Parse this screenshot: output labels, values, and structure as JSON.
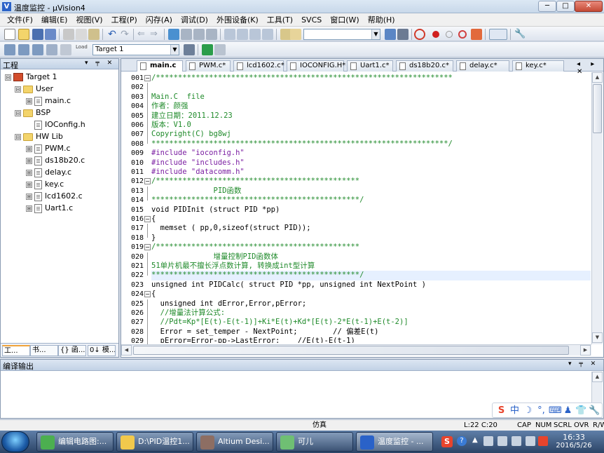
{
  "window": {
    "title": "温度监控 - μVision4",
    "app_icon": "V",
    "minimize": "─",
    "maximize": "□",
    "close": "✕"
  },
  "menu": [
    "文件(F)",
    "编辑(E)",
    "视图(V)",
    "工程(P)",
    "闪存(A)",
    "调试(D)",
    "外围设备(K)",
    "工具(T)",
    "SVCS",
    "窗口(W)",
    "帮助(H)"
  ],
  "toolbar2": {
    "target_select": "Target 1",
    "load_label": "Load"
  },
  "project": {
    "title": "工程",
    "controls": "▾ ╤ ✕",
    "tree": [
      {
        "label": "Target 1",
        "kind": "target",
        "level": 0,
        "expander": "⊟"
      },
      {
        "label": "User",
        "kind": "folder",
        "level": 1,
        "expander": "⊟"
      },
      {
        "label": "main.c",
        "kind": "file",
        "level": 2,
        "expander": "⊞"
      },
      {
        "label": "BSP",
        "kind": "folder",
        "level": 1,
        "expander": "⊟"
      },
      {
        "label": "IOConfig.h",
        "kind": "file",
        "level": 2,
        "expander": ""
      },
      {
        "label": "HW Lib",
        "kind": "folder",
        "level": 1,
        "expander": "⊟"
      },
      {
        "label": "PWM.c",
        "kind": "file",
        "level": 2,
        "expander": "⊞"
      },
      {
        "label": "ds18b20.c",
        "kind": "file",
        "level": 2,
        "expander": "⊞"
      },
      {
        "label": "delay.c",
        "kind": "file",
        "level": 2,
        "expander": "⊞"
      },
      {
        "label": "key.c",
        "kind": "file",
        "level": 2,
        "expander": "⊞"
      },
      {
        "label": "lcd1602.c",
        "kind": "file",
        "level": 2,
        "expander": "⊞"
      },
      {
        "label": "Uart1.c",
        "kind": "file",
        "level": 2,
        "expander": "⊞"
      }
    ],
    "tabs": [
      "工...",
      "书...",
      "{} 函...",
      "0↓ 模..."
    ]
  },
  "editor": {
    "tabs": [
      "main.c",
      "PWM.c*",
      "lcd1602.c*",
      "IOCONFIG.H*",
      "Uart1.c*",
      "ds18b20.c*",
      "delay.c*",
      "key.c*"
    ],
    "active_tab": 0,
    "tab_controls": "◂ ▸ ✕",
    "lines": [
      {
        "n": "001",
        "text": "/*******************************************************************",
        "style": "comment",
        "fold": "⊟"
      },
      {
        "n": "002",
        "text": "",
        "style": "comment",
        "fold": "│"
      },
      {
        "n": "003",
        "text": "Main.C  file",
        "style": "comment",
        "fold": "│"
      },
      {
        "n": "004",
        "text": "作者：颜强",
        "style": "comment",
        "fold": "│"
      },
      {
        "n": "005",
        "text": "建立日期：2011.12.23",
        "style": "comment",
        "fold": "│"
      },
      {
        "n": "006",
        "text": "版本：V1.0",
        "style": "comment",
        "fold": "│"
      },
      {
        "n": "007",
        "text": "Copyright(C) bg8wj",
        "style": "comment",
        "fold": "│"
      },
      {
        "n": "008",
        "text": "*******************************************************************/",
        "style": "comment",
        "fold": "└"
      },
      {
        "n": "009",
        "text": "#include \"ioconfig.h\"",
        "style": "pp",
        "fold": ""
      },
      {
        "n": "010",
        "text": "#include \"includes.h\"",
        "style": "pp",
        "fold": ""
      },
      {
        "n": "011",
        "text": "#include \"datacomm.h\"",
        "style": "pp",
        "fold": ""
      },
      {
        "n": "012",
        "text": "/**********************************************",
        "style": "comment",
        "fold": "⊟"
      },
      {
        "n": "013",
        "text": "              PID函数",
        "style": "comment",
        "fold": "│"
      },
      {
        "n": "014",
        "text": "***********************************************/",
        "style": "comment",
        "fold": "└"
      },
      {
        "n": "015",
        "text": "void PIDInit (struct PID *pp)",
        "style": "code",
        "fold": ""
      },
      {
        "n": "016",
        "text": "{",
        "style": "code",
        "fold": "⊟"
      },
      {
        "n": "017",
        "text": "  memset ( pp,0,sizeof(struct PID));",
        "style": "code",
        "fold": "│"
      },
      {
        "n": "018",
        "text": "}",
        "style": "code",
        "fold": "└"
      },
      {
        "n": "019",
        "text": "/**********************************************",
        "style": "comment",
        "fold": "⊟"
      },
      {
        "n": "020",
        "text": "              增量控制PID函数体",
        "style": "comment",
        "fold": "│"
      },
      {
        "n": "021",
        "text": "51单片机最不擅长浮点数计算, 转换成int型计算",
        "style": "comment",
        "fold": "│"
      },
      {
        "n": "022",
        "text": "***********************************************/",
        "style": "comment",
        "fold": "└"
      },
      {
        "n": "023",
        "text": "unsigned int PIDCalc( struct PID *pp, unsigned int NextPoint )",
        "style": "code",
        "fold": ""
      },
      {
        "n": "024",
        "text": "{",
        "style": "code",
        "fold": "⊟"
      },
      {
        "n": "025",
        "text": "  unsigned int dError,Error,pError;",
        "style": "code",
        "fold": "│"
      },
      {
        "n": "026",
        "text": "  //增量法计算公式:",
        "style": "comment",
        "fold": "│"
      },
      {
        "n": "027",
        "text": "  //Pdt=Kp*[E(t)-E(t-1)]+Ki*E(t)+Kd*[E(t)-2*E(t-1)+E(t-2)]",
        "style": "comment",
        "fold": "│"
      },
      {
        "n": "028",
        "text": "  Error = set_temper - NextPoint;        // 偏差E(t)",
        "style": "mixed",
        "fold": "│"
      },
      {
        "n": "029",
        "text": "  pError=Error-pp->LastError;    //E(t)-E(t-1)",
        "style": "mixed",
        "fold": "│"
      }
    ],
    "highlight_line": 22
  },
  "build": {
    "title": "编译输出",
    "controls": "▾ ╤ ✕"
  },
  "ime": {
    "items": [
      "S",
      "中",
      "☽",
      "°,",
      "⌨",
      "♟",
      "👕",
      "🔧"
    ]
  },
  "status": {
    "mode": "仿真",
    "position": "L:22 C:20",
    "indicators": [
      "CAP",
      "NUM",
      "SCRL",
      "OVR",
      "R/W"
    ]
  },
  "taskbar": {
    "items": [
      {
        "label": "编辑电路图:...",
        "color": "#4caf50"
      },
      {
        "label": "D:\\PID温控1...",
        "color": "#f2c94c"
      },
      {
        "label": "Altium Desi...",
        "color": "#8d6e63"
      },
      {
        "label": "可儿",
        "color": "#6fbf73"
      },
      {
        "label": "温度监控 - ...",
        "color": "#2a62c8"
      }
    ],
    "time": "16:33",
    "date": "2016/5/26"
  }
}
